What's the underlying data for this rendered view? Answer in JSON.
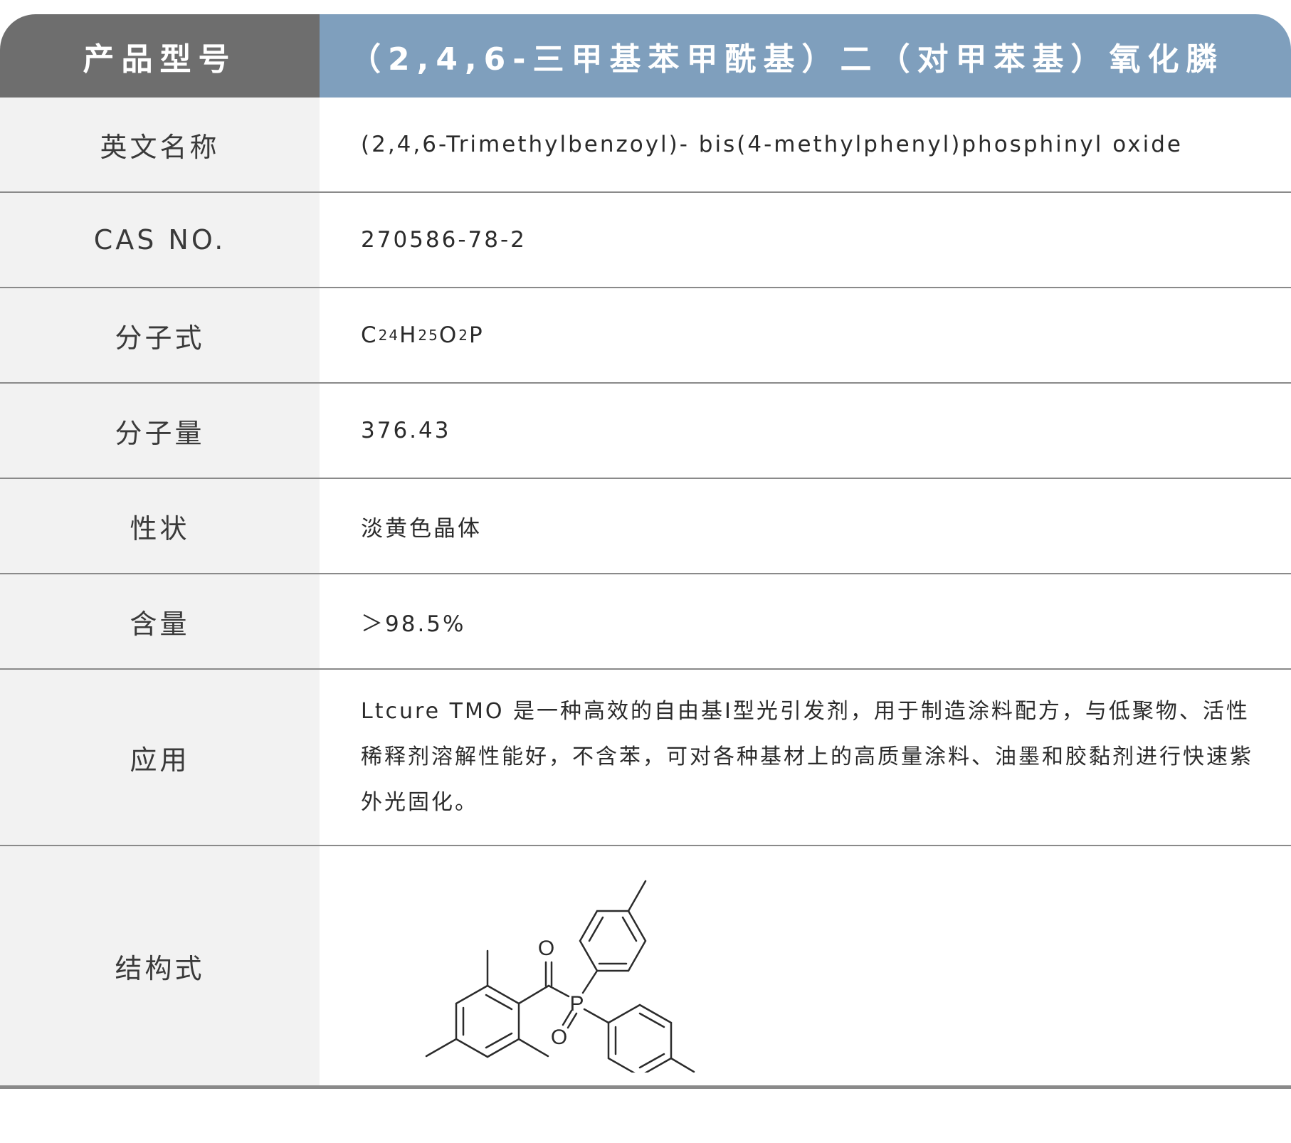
{
  "header": {
    "label": "产品型号",
    "value": "（2,4,6-三甲基苯甲酰基）二（对甲苯基）氧化膦"
  },
  "rows": {
    "english_name": {
      "label": "英文名称",
      "value": "(2,4,6-Trimethylbenzoyl)- bis(4-methylphenyl)phosphinyl oxide"
    },
    "cas": {
      "label": "CAS NO.",
      "value": "270586-78-2"
    },
    "formula": {
      "label": "分子式",
      "parts": {
        "c": "C",
        "c_n": "24",
        "h": "H",
        "h_n": "25",
        "o": "O",
        "o_n": "2",
        "p": "P"
      }
    },
    "mol_weight": {
      "label": "分子量",
      "value": "376.43"
    },
    "appearance": {
      "label": "性状",
      "value": "淡黄色晶体"
    },
    "content": {
      "label": "含量",
      "value": "＞98.5%"
    },
    "application": {
      "label": "应用",
      "value": "Ltcure TMO 是一种高效的自由基I型光引发剂，用于制造涂料配方，与低聚物、活性稀释剂溶解性能好，不含苯，可对各种基材上的高质量涂料、油墨和胶黏剂进行快速紫外光固化。"
    },
    "structure": {
      "label": "结构式",
      "atoms": {
        "o_carbonyl": "O",
        "phosphorus": "P",
        "o_phosphoryl": "O"
      }
    }
  },
  "colors": {
    "header_label_bg": "#6e6e6e",
    "header_value_bg": "#7f9fbd",
    "label_bg": "#f2f2f2",
    "divider": "#8a8a8a"
  }
}
